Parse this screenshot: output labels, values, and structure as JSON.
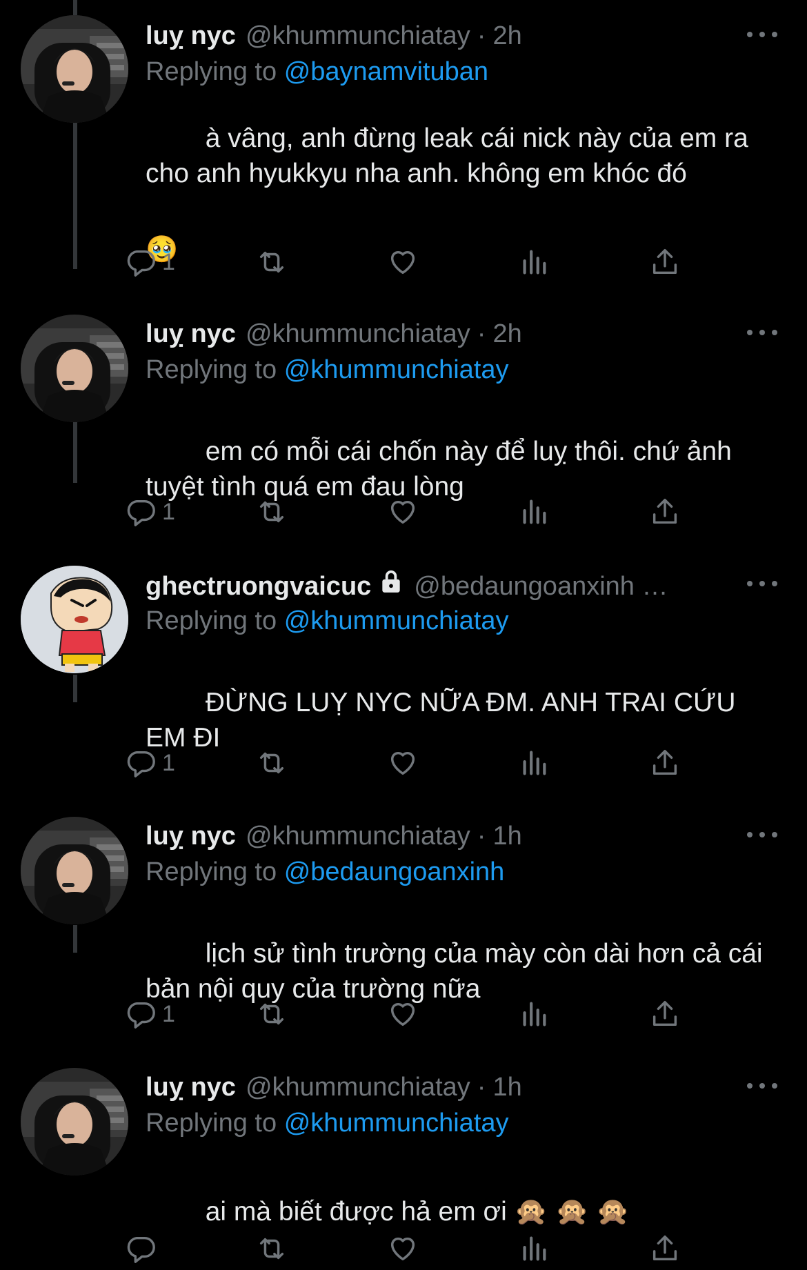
{
  "colors": {
    "background": "#000000",
    "text": "#e7e9ea",
    "secondary": "#71767b",
    "mention": "#1d9bf0",
    "thread_line": "#333639"
  },
  "labels": {
    "replying_to": "Replying to"
  },
  "tweets": [
    {
      "name": "luỵ nyc",
      "handle": "@khummunchiatay",
      "time": "2h",
      "reply_to": "@baynamvituban",
      "text": "à vâng, anh đừng leak cái nick này của em ra cho anh hyukkyu nha anh. không em khóc đó",
      "emoji": "🥹",
      "reply_count": "1",
      "avatar": "person-avatar"
    },
    {
      "name": "luỵ nyc",
      "handle": "@khummunchiatay",
      "time": "2h",
      "reply_to": "@khummunchiatay",
      "text": "em có mỗi cái chốn này để luỵ thôi. chứ ảnh tuyệt tình quá em đau lòng",
      "emoji": "",
      "reply_count": "1",
      "avatar": "person-avatar"
    },
    {
      "name": "ghectruongvaicuc",
      "handle": "@bedaungoanxinh …",
      "time": "",
      "reply_to": "@khummunchiatay",
      "text": "ĐỪNG LUỴ NYC NỮA ĐM. ANH TRAI CỨU EM ĐI",
      "emoji": "",
      "reply_count": "1",
      "avatar": "cartoon-avatar",
      "locked": true
    },
    {
      "name": "luỵ nyc",
      "handle": "@khummunchiatay",
      "time": "1h",
      "reply_to": "@bedaungoanxinh",
      "text": "lịch sử tình trường của mày còn dài hơn cả cái bản nội quy của trường nữa",
      "emoji": "",
      "reply_count": "1",
      "avatar": "person-avatar"
    },
    {
      "name": "luỵ nyc",
      "handle": "@khummunchiatay",
      "time": "1h",
      "reply_to": "@khummunchiatay",
      "text": "ai mà biết được hả em ơi 🙊 🙊 🙊",
      "emoji": "",
      "reply_count": "",
      "avatar": "person-avatar"
    }
  ],
  "icons": {
    "reply": "reply-icon",
    "retweet": "retweet-icon",
    "like": "heart-icon",
    "views": "views-icon",
    "share": "share-icon",
    "more": "more-icon",
    "lock": "lock-icon"
  }
}
